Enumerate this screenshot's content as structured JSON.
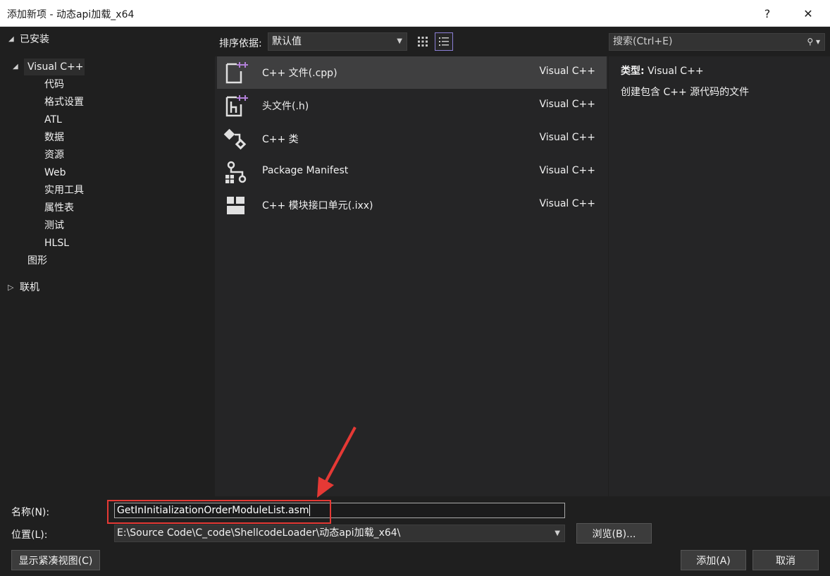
{
  "window": {
    "title": "添加新项 - 动态api加载_x64",
    "help_glyph": "?",
    "close_glyph": "✕"
  },
  "sidebar": {
    "installed_label": "已安装",
    "root_label": "Visual C++",
    "children": [
      "代码",
      "格式设置",
      "ATL",
      "数据",
      "资源",
      "Web",
      "实用工具",
      "属性表",
      "测试",
      "HLSL"
    ],
    "graphics_label": "图形",
    "online_label": "联机"
  },
  "toolbar": {
    "sort_label": "排序依据:",
    "sort_value": "默认值"
  },
  "search": {
    "placeholder": "搜索(Ctrl+E)"
  },
  "templates": [
    {
      "name": "C++ 文件(.cpp)",
      "lang": "Visual C++",
      "icon": "cpp-file-icon"
    },
    {
      "name": "头文件(.h)",
      "lang": "Visual C++",
      "icon": "header-file-icon"
    },
    {
      "name": "C++ 类",
      "lang": "Visual C++",
      "icon": "class-icon"
    },
    {
      "name": "Package Manifest",
      "lang": "Visual C++",
      "icon": "package-manifest-icon"
    },
    {
      "name": "C++ 模块接口单元(.ixx)",
      "lang": "Visual C++",
      "icon": "module-icon"
    }
  ],
  "details": {
    "type_label": "类型:",
    "type_value": "Visual C++",
    "description": "创建包含 C++ 源代码的文件"
  },
  "form": {
    "name_label": "名称(N):",
    "name_value": "GetInInitializationOrderModuleList.asm",
    "location_label": "位置(L):",
    "location_value": "E:\\Source Code\\C_code\\ShellcodeLoader\\动态api加载_x64\\",
    "browse_label": "浏览(B)...",
    "compact_label": "显示紧凑视图(C)",
    "add_label": "添加(A)",
    "cancel_label": "取消"
  },
  "colors": {
    "accent_purple": "#b180d7",
    "highlight_red": "#e53935"
  }
}
